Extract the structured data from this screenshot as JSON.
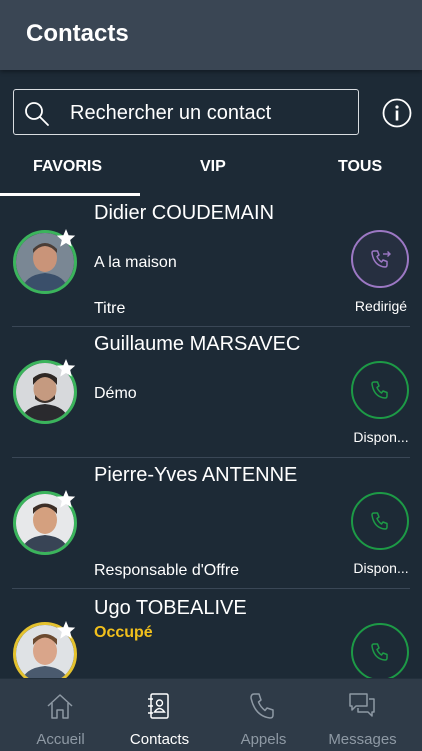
{
  "header": {
    "title": "Contacts"
  },
  "search": {
    "placeholder": "Rechercher un contact"
  },
  "tabs": [
    {
      "label": "FAVORIS",
      "active": true
    },
    {
      "label": "VIP",
      "active": false
    },
    {
      "label": "TOUS",
      "active": false
    }
  ],
  "contacts": [
    {
      "name": "Didier COUDEMAIN",
      "line2": "A la maison",
      "line3": "Titre",
      "call_status": "Redirigé",
      "status_color": "#3bb45c",
      "call_icon": "phone-forward-icon",
      "favorite": true
    },
    {
      "name": "Guillaume MARSAVEC",
      "line2": "Démo",
      "line3": "",
      "call_status": "Dispon...",
      "status_color": "#3bb45c",
      "call_icon": "phone-icon",
      "favorite": true
    },
    {
      "name": "Pierre-Yves ANTENNE",
      "line2": "",
      "line3": "Responsable d'Offre",
      "call_status": "Dispon...",
      "status_color": "#3bb45c",
      "call_icon": "phone-icon",
      "favorite": true
    },
    {
      "name": "Ugo TOBEALIVE",
      "line2": "Occupé",
      "line3": "",
      "call_status": "",
      "status_color": "#e4c22e",
      "call_icon": "phone-icon",
      "favorite": true
    }
  ],
  "bottom_nav": [
    {
      "label": "Accueil",
      "icon": "home-icon",
      "active": false
    },
    {
      "label": "Contacts",
      "icon": "address-book-icon",
      "active": true
    },
    {
      "label": "Appels",
      "icon": "phone-icon",
      "active": false
    },
    {
      "label": "Messages",
      "icon": "chat-icon",
      "active": false
    }
  ],
  "colors": {
    "background": "#1d2a36",
    "header": "#3a4654",
    "available": "#1d9a46",
    "forwarded": "#9c78c4",
    "busy": "#f2c01c"
  }
}
